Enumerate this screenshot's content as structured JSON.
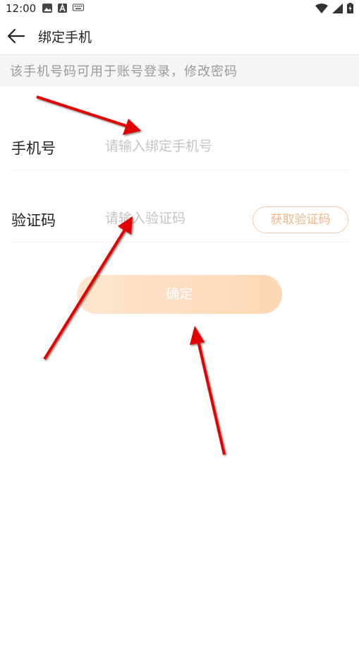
{
  "status_bar": {
    "time": "12:00",
    "icons_left": [
      "image-icon",
      "a-icon",
      "keyboard-icon"
    ],
    "icons_right": [
      "wifi-icon",
      "signal-icon",
      "battery-icon"
    ]
  },
  "app_bar": {
    "title": "绑定手机",
    "back_icon": "back-arrow-icon"
  },
  "hint": "该手机号码可用于账号登录，修改密码",
  "phone_field": {
    "label": "手机号",
    "placeholder": "请输入绑定手机号",
    "value": ""
  },
  "code_field": {
    "label": "验证码",
    "placeholder": "请输入验证码",
    "value": "",
    "get_code_label": "获取验证码"
  },
  "confirm_label": "确定",
  "colors": {
    "accent": "#f2b48a",
    "button_start": "#fde6cf",
    "button_end": "#fdd7b4",
    "annotation_arrow": "#e30000"
  }
}
